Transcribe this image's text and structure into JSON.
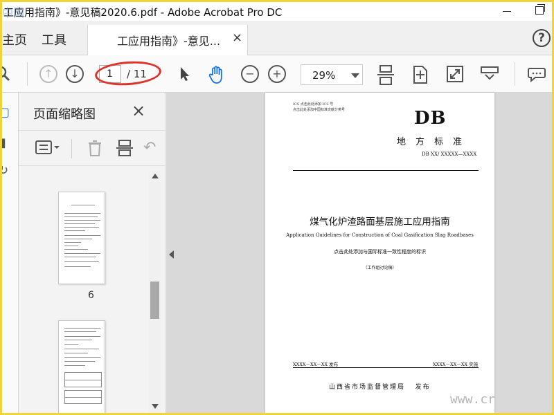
{
  "window": {
    "title": "工应用指南》-意见稿2020.6.pdf - Adobe Acrobat Pro DC",
    "watermark_top_left": "中国",
    "watermark_bottom_right": "www.cr"
  },
  "tabbar": {
    "home_label": "主页",
    "tools_label": "工具",
    "document_tab_label": "工应用指南》-意见...",
    "document_tab_close": "×",
    "help_label": "?"
  },
  "toolbar": {
    "current_page": "1",
    "total_pages": "/ 11",
    "zoom_value": "29%"
  },
  "thumbnails_panel": {
    "title": "页面缩略图",
    "close_label": "×",
    "pages": [
      {
        "number": "6"
      },
      {
        "number": ""
      }
    ]
  },
  "document_page": {
    "ics_line": "ICS 点击此处添加 ICS 号",
    "ccs_line": "点击此处添加中国标准文献分类号",
    "db_label": "DB",
    "standard_type": "地方标准",
    "standard_code": "DB XX/ XXXXX—XXXX",
    "title_cn": "煤气化炉渣路面基层施工应用指南",
    "title_en": "Application Guidelines for Construction of Coal Gasification Slag Roadbases",
    "consistency_note": "点击此处添加与国际标准一致性程度的标识",
    "draft_note": "（工作组讨论稿）",
    "release_date": "XXXX－XX－XX 发布",
    "implement_date": "XXXX－XX－XX 实施",
    "issuer": "山西省市场监督管理局",
    "issuer_suffix": "发布"
  },
  "colors": {
    "accent_blue": "#1473e6",
    "annotation_red": "#e0302a",
    "frame_yellow": "#f2d33a"
  }
}
